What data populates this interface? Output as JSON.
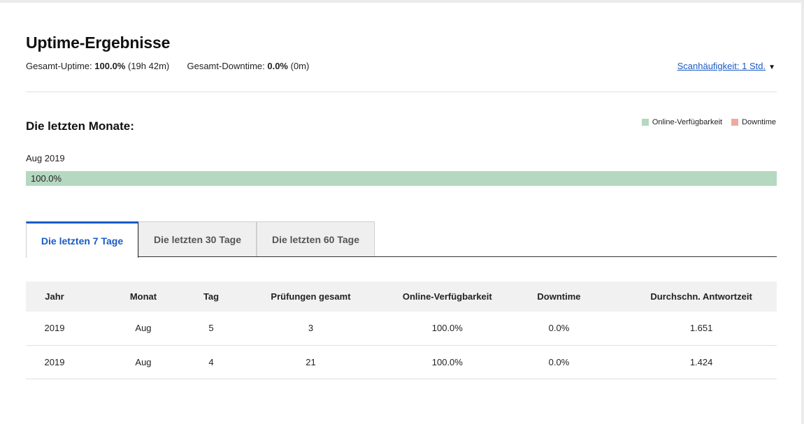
{
  "header": {
    "title": "Uptime-Ergebnisse",
    "uptime_label": "Gesamt-Uptime:",
    "uptime_value": "100.0%",
    "uptime_duration": "(19h 42m)",
    "downtime_label": "Gesamt-Downtime:",
    "downtime_value": "0.0%",
    "downtime_duration": "(0m)",
    "scan_link": "Scanhäufigkeit: 1 Std."
  },
  "months_section": {
    "title": "Die letzten Monate:",
    "legend": {
      "online": "Online-Verfügbarkeit",
      "downtime": "Downtime"
    },
    "months": [
      {
        "label": "Aug 2019",
        "uptime_percent": 100.0,
        "uptime_text": "100.0%"
      }
    ]
  },
  "tabs": [
    {
      "label": "Die letzten 7 Tage",
      "active": true
    },
    {
      "label": "Die letzten 30 Tage",
      "active": false
    },
    {
      "label": "Die letzten 60 Tage",
      "active": false
    }
  ],
  "table": {
    "columns": [
      "Jahr",
      "Monat",
      "Tag",
      "Prüfungen gesamt",
      "Online-Verfügbarkeit",
      "Downtime",
      "Durchschn. Antwortzeit"
    ],
    "rows": [
      [
        "2019",
        "Aug",
        "5",
        "3",
        "100.0%",
        "0.0%",
        "1.651"
      ],
      [
        "2019",
        "Aug",
        "4",
        "21",
        "100.0%",
        "0.0%",
        "1.424"
      ]
    ]
  },
  "colors": {
    "accent": "#1a5bc4",
    "online": "#b5d8c0",
    "downtime": "#f0a9a0"
  }
}
